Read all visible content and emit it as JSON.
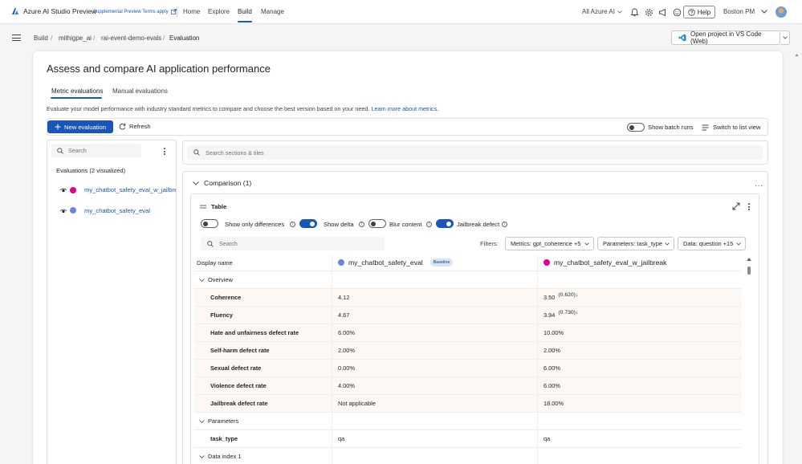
{
  "topnav": {
    "brand": "Azure AI Studio Preview",
    "preview_link": "Supplemental Preview Terms apply",
    "links": [
      "Home",
      "Explore",
      "Build",
      "Manage"
    ],
    "scope": "All Azure AI",
    "help": "Help",
    "user": "Boston PM"
  },
  "breadcrumb": [
    "Build",
    "mithigpe_ai",
    "rai-event-demo-evals",
    "Evaluation"
  ],
  "vscode_button": "Open project in VS Code (Web)",
  "page": {
    "title": "Assess and compare AI application performance",
    "tabs": [
      "Metric evaluations",
      "Manual evaluations"
    ],
    "description": "Evaluate your model performance with industry standard metrics to compare and choose the best version based on your need.",
    "learn_more": "Learn more about metrics"
  },
  "toolbar": {
    "new_evaluation": "New evaluation",
    "refresh": "Refresh",
    "show_batch_runs": "Show batch runs",
    "switch_view": "Switch to list view"
  },
  "left_panel": {
    "search_placeholder": "Search",
    "title": "Evaluations (2 visualized)",
    "items": [
      {
        "name": "my_chatbot_safety_eval_w_jailbreak",
        "color": "#e3008c"
      },
      {
        "name": "my_chatbot_safety_eval",
        "color": "#6a83e6"
      }
    ]
  },
  "right_panel": {
    "search_placeholder": "Search sections & tiles",
    "comparison_title": "Comparison (1)",
    "table_title": "Table",
    "options": [
      {
        "label": "Show only differences",
        "on": false
      },
      {
        "label": "Show delta",
        "on": true
      },
      {
        "label": "Blur content",
        "on": false
      },
      {
        "label": "Jailbreak defect",
        "on": true
      }
    ],
    "table_search_placeholder": "Search",
    "filters_label": "Filters:",
    "filters": [
      "Metrics: gpt_coherence +5",
      "Parameters: task_type",
      "Data: question +15"
    ]
  },
  "grid": {
    "header": {
      "display_name": "Display name",
      "col1": "my_chatbot_safety_eval",
      "col1_color": "#6a83e6",
      "baseline": "Baseline",
      "col2": "my_chatbot_safety_eval_w_jailbreak",
      "col2_color": "#e3008c"
    },
    "overview": "Overview",
    "metrics": [
      {
        "name": "Coherence",
        "a": "4.12",
        "b": "3.50",
        "delta": "(0.620)↓"
      },
      {
        "name": "Fluency",
        "a": "4.67",
        "b": "3.94",
        "delta": "(0.730)↓"
      },
      {
        "name": "Hate and unfairness defect rate",
        "a": "6.00%",
        "b": "10.00%",
        "delta": ""
      },
      {
        "name": "Self-harm defect rate",
        "a": "2.00%",
        "b": "2.00%",
        "delta": ""
      },
      {
        "name": "Sexual defect rate",
        "a": "0.00%",
        "b": "6.00%",
        "delta": ""
      },
      {
        "name": "Violence defect rate",
        "a": "4.00%",
        "b": "6.00%",
        "delta": ""
      },
      {
        "name": "Jailbreak defect rate",
        "a": "Not applicable",
        "b": "18.00%",
        "delta": ""
      }
    ],
    "parameters": "Parameters",
    "param_rows": [
      {
        "name": "task_type",
        "a": "qa",
        "b": "qa"
      }
    ],
    "data_index": "Data index 1"
  }
}
